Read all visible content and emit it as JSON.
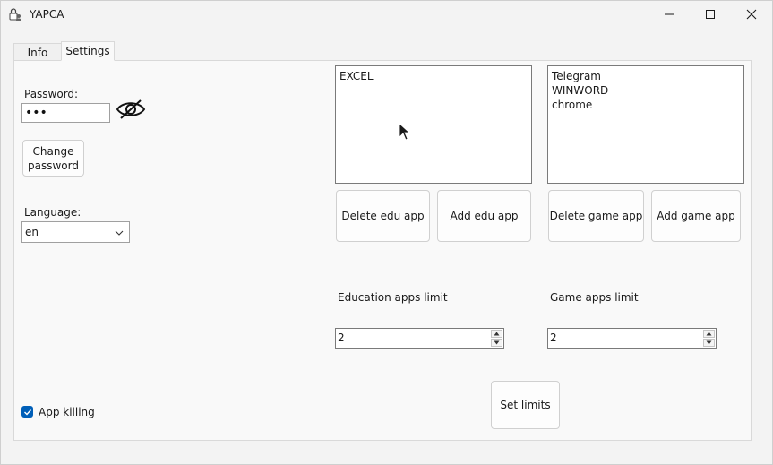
{
  "window": {
    "title": "YAPCA"
  },
  "tabs": [
    {
      "label": "Info"
    },
    {
      "label": "Settings"
    }
  ],
  "settings": {
    "password_label": "Password:",
    "password_value": "•••",
    "change_password_label": [
      "Change",
      "password"
    ],
    "language_label": "Language:",
    "language_value": "en",
    "edu_apps": [
      "EXCEL"
    ],
    "game_apps": [
      "Telegram",
      "WINWORD",
      "chrome"
    ],
    "delete_edu_label": "Delete edu app",
    "add_edu_label": "Add edu app",
    "delete_game_label": "Delete game app",
    "add_game_label": "Add game app",
    "edu_limit_label": "Education apps limit",
    "game_limit_label": "Game apps limit",
    "edu_limit_value": "2",
    "game_limit_value": "2",
    "set_limits_label": "Set limits",
    "app_killing_label": "App killing",
    "app_killing_checked": true
  },
  "colors": {
    "accent": "#005fb8"
  }
}
